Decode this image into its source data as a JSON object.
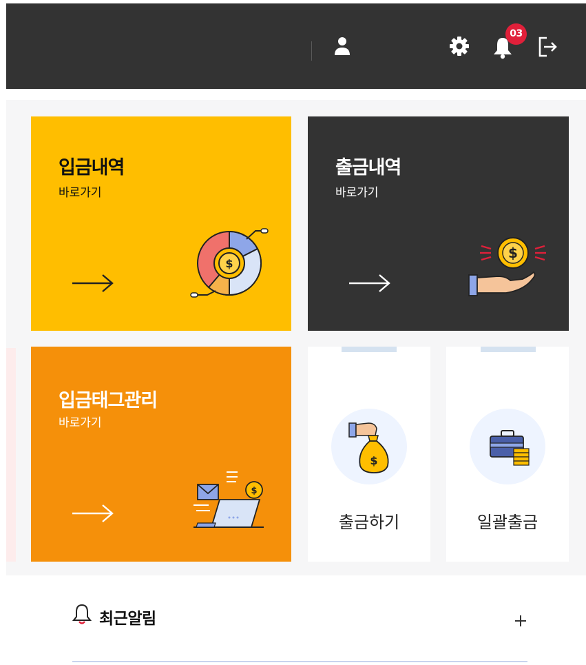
{
  "header": {
    "notification_count": "03",
    "icons": [
      "user-icon",
      "gear-icon",
      "bell-icon",
      "logout-icon"
    ]
  },
  "cards": {
    "deposit": {
      "title": "입금내역",
      "sub": "바로가기",
      "color": "#ffbe00"
    },
    "withdraw": {
      "title": "출금내역",
      "sub": "바로가기",
      "color": "#333333"
    },
    "tag": {
      "title": "입금태그관리",
      "sub": "바로가기",
      "color": "#f5900a"
    }
  },
  "quick": {
    "withdraw_label": "출금하기",
    "bulk_label": "일괄출금"
  },
  "notifications": {
    "title": "최근알림",
    "more_label": "+"
  }
}
